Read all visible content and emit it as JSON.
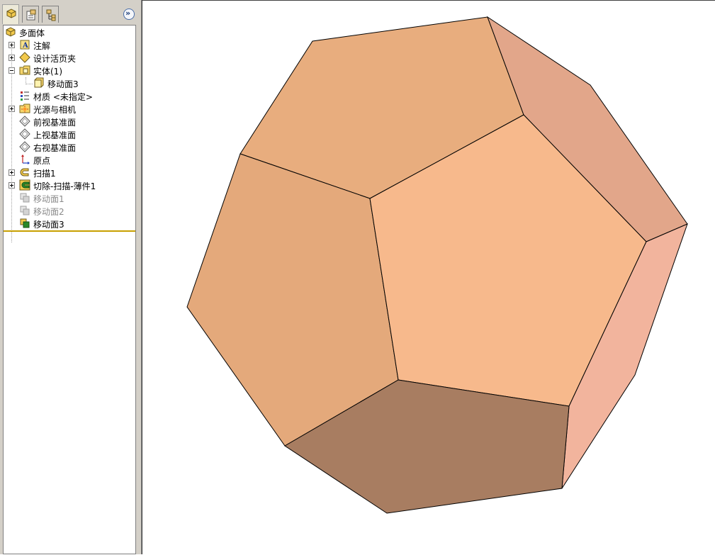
{
  "feature_manager": {
    "tabs": [
      {
        "name": "featuremanager-tab",
        "active": true
      },
      {
        "name": "propertymanager-tab",
        "active": false
      },
      {
        "name": "configurationmanager-tab",
        "active": false
      }
    ],
    "collapse_label": "»",
    "tree": [
      {
        "label": "多面体",
        "icon": "part-icon",
        "expander": "none",
        "dim": false
      },
      {
        "label": "注解",
        "icon": "annotations-icon",
        "expander": "plus",
        "dim": false
      },
      {
        "label": "设计活页夹",
        "icon": "design-binder-icon",
        "expander": "plus",
        "dim": false
      },
      {
        "label": "实体(1)",
        "icon": "solid-bodies-folder-icon",
        "expander": "minus",
        "dim": false
      },
      {
        "label": "移动面3",
        "icon": "solid-body-icon",
        "expander": "none",
        "dim": false
      },
      {
        "label": "材质 <未指定>",
        "icon": "material-icon",
        "expander": "none",
        "dim": false
      },
      {
        "label": "光源与相机",
        "icon": "lights-cameras-icon",
        "expander": "plus",
        "dim": false
      },
      {
        "label": "前视基准面",
        "icon": "plane-icon",
        "expander": "none",
        "dim": false
      },
      {
        "label": "上视基准面",
        "icon": "plane-icon",
        "expander": "none",
        "dim": false
      },
      {
        "label": "右视基准面",
        "icon": "plane-icon",
        "expander": "none",
        "dim": false
      },
      {
        "label": "原点",
        "icon": "origin-icon",
        "expander": "none",
        "dim": false
      },
      {
        "label": "扫描1",
        "icon": "sweep-icon",
        "expander": "plus",
        "dim": false
      },
      {
        "label": "切除-扫描-薄件1",
        "icon": "cut-sweep-icon",
        "expander": "plus",
        "dim": false
      },
      {
        "label": "移动面1",
        "icon": "move-face-icon",
        "expander": "none",
        "dim": true
      },
      {
        "label": "移动面2",
        "icon": "move-face-icon",
        "expander": "none",
        "dim": true
      },
      {
        "label": "移动面3",
        "icon": "move-face-icon",
        "expander": "none",
        "dim": false
      }
    ]
  },
  "model": {
    "name": "dodecahedron",
    "colors": {
      "top_face": "#e8ad7e",
      "front_face": "#f7b98c",
      "left_face": "#e4a97b",
      "right_upper_face": "#e2a68a",
      "right_lower_face": "#f2b49d",
      "bottom_face": "#a87d61",
      "edge": "#000000"
    }
  }
}
